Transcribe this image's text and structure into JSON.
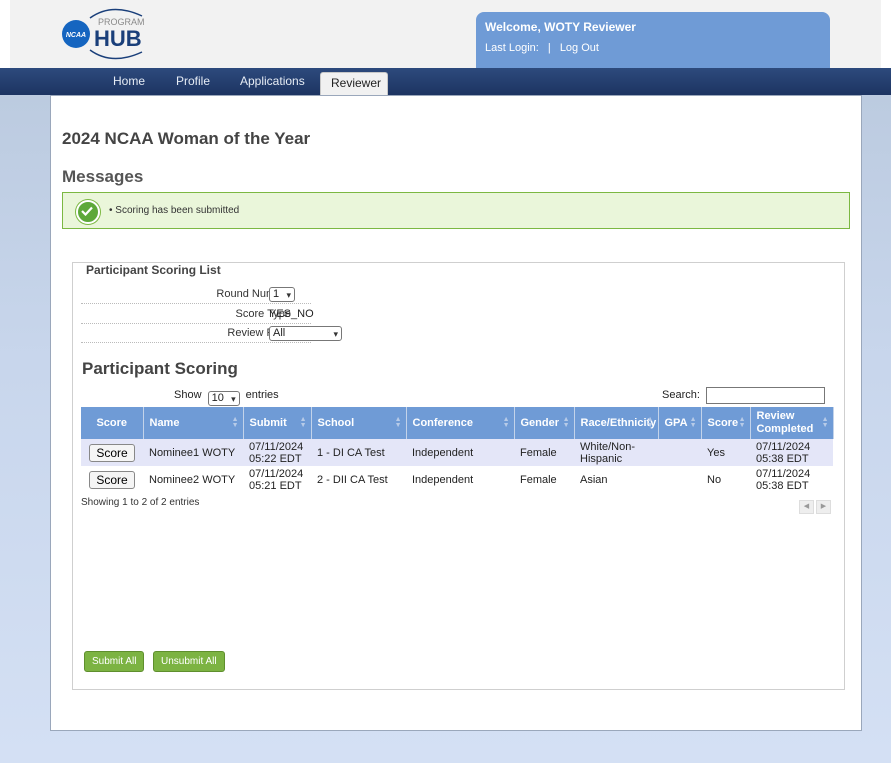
{
  "header": {
    "logo_ncaa": "NCAA",
    "logo_program": "PROGRAM",
    "logo_hub": "HUB",
    "welcome": "Welcome, WOTY Reviewer",
    "last_login_label": "Last Login:",
    "separator": "|",
    "logout": "Log Out"
  },
  "nav": {
    "tabs": [
      {
        "label": "Home"
      },
      {
        "label": "Profile"
      },
      {
        "label": "Applications"
      },
      {
        "label": "Reviewer"
      }
    ],
    "active": "Reviewer"
  },
  "page": {
    "title": "2024 NCAA Woman of the Year",
    "messages_title": "Messages",
    "message": "Scoring has been submitted"
  },
  "scoring_list": {
    "legend": "Participant Scoring List",
    "round_number_label": "Round Number",
    "round_number_value": "1",
    "score_type_label": "Score Type",
    "score_type_value": "YES_NO",
    "review_filter_label": "Review Filter",
    "review_filter_value": "All"
  },
  "table": {
    "title": "Participant Scoring",
    "show_label": "Show",
    "entries_value": "10",
    "entries_label": "entries",
    "search_label": "Search:",
    "headers": [
      "Score",
      "Name",
      "Submit",
      "School",
      "Conference",
      "Gender",
      "Race/Ethnicity",
      "GPA",
      "Score",
      "Review Completed"
    ],
    "rows": [
      {
        "button": "Score",
        "name": "Nominee1 WOTY",
        "submit": "07/11/2024 05:22 EDT",
        "school": "1 - DI CA Test",
        "conference": "Independent",
        "gender": "Female",
        "race": "White/Non-Hispanic",
        "gpa": "",
        "score": "Yes",
        "review_completed": "07/11/2024 05:38 EDT"
      },
      {
        "button": "Score",
        "name": "Nominee2 WOTY",
        "submit": "07/11/2024 05:21 EDT",
        "school": "2 - DII CA Test",
        "conference": "Independent",
        "gender": "Female",
        "race": "Asian",
        "gpa": "",
        "score": "No",
        "review_completed": "07/11/2024 05:38 EDT"
      }
    ],
    "info": "Showing 1 to 2 of 2 entries"
  },
  "actions": {
    "submit_all": "Submit All",
    "unsubmit_all": "Unsubmit All"
  },
  "colors": {
    "nav_bg": "#1d3462",
    "header_blue": "#6f9bd6",
    "success_green": "#7cb342",
    "row_highlight": "#e4e6f8"
  }
}
